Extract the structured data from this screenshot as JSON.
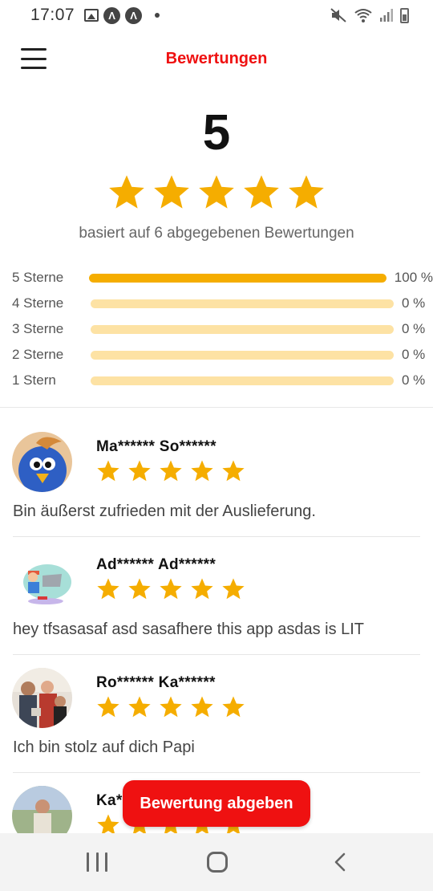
{
  "status_bar": {
    "time": "17:07",
    "left_icons": [
      "image-icon",
      "app-a-icon",
      "app-a-icon",
      "dot-icon"
    ],
    "right_icons": [
      "mute-icon",
      "wifi-icon",
      "signal-icon",
      "battery-icon"
    ],
    "app_a_glyph": "Λ"
  },
  "header": {
    "title": "Bewertungen",
    "menu_icon": "hamburger-icon"
  },
  "summary": {
    "average": "5",
    "stars": 5,
    "based_on": "basiert auf 6 abgegebenen Bewertungen"
  },
  "distribution": [
    {
      "label": "5 Sterne",
      "percent_text": "100 %",
      "fraction": 1.0
    },
    {
      "label": "4 Sterne",
      "percent_text": "0 %",
      "fraction": 0
    },
    {
      "label": "3 Sterne",
      "percent_text": "0 %",
      "fraction": 0
    },
    {
      "label": "2 Sterne",
      "percent_text": "0 %",
      "fraction": 0
    },
    {
      "label": "1 Stern",
      "percent_text": "0 %",
      "fraction": 0
    }
  ],
  "reviews": [
    {
      "name": "Ma****** So******",
      "stars": 5,
      "text": "Bin äußerst zufrieden mit der Auslieferung.",
      "avatar": "bird-avatar"
    },
    {
      "name": "Ad****** Ad******",
      "stars": 5,
      "text": "hey tfsasasaf asd sasafhere this app asdas is LIT",
      "avatar": "illustration-avatar"
    },
    {
      "name": "Ro****** Ka******",
      "stars": 5,
      "text": "Ich bin stolz auf dich Papi",
      "avatar": "family-photo-avatar"
    },
    {
      "name": "Ka*",
      "stars": 5,
      "text": "",
      "avatar": "person-photo-avatar"
    }
  ],
  "fab": {
    "label": "Bewertung abgeben"
  },
  "nav_bar": {
    "icons": [
      "recent-apps-icon",
      "home-icon",
      "back-icon"
    ]
  },
  "colors": {
    "accent_red": "#ef1111",
    "star_yellow": "#f5ad00",
    "bar_track": "#fde2a4"
  }
}
